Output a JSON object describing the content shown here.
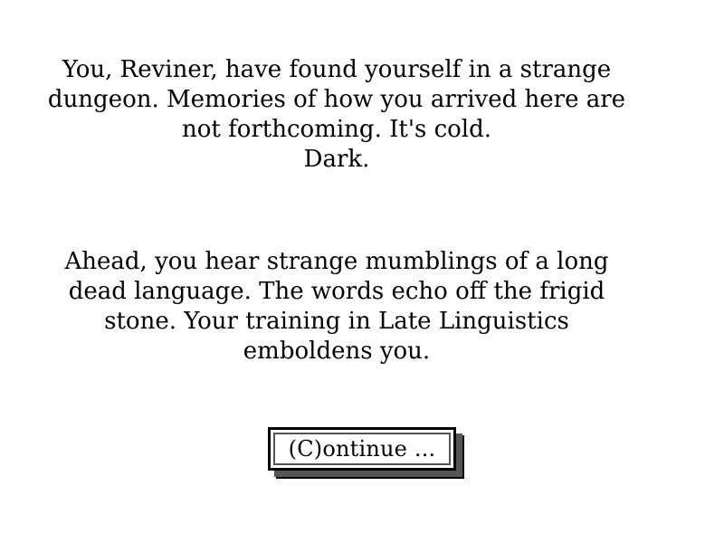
{
  "story": {
    "paragraph1": [
      "You, Reviner, have found yourself in a strange",
      "dungeon. Memories of how you arrived here are",
      "not forthcoming. It's cold.",
      "Dark."
    ],
    "paragraph2": [
      "Ahead, you hear strange mumblings of a long",
      "dead language. The words echo off the frigid",
      "stone. Your training in Late Linguistics",
      "emboldens you."
    ]
  },
  "controls": {
    "continue_label": "(C)ontinue ..."
  },
  "colors": {
    "background": "#ffffff",
    "text": "#000000",
    "button_shadow": "#555555"
  }
}
